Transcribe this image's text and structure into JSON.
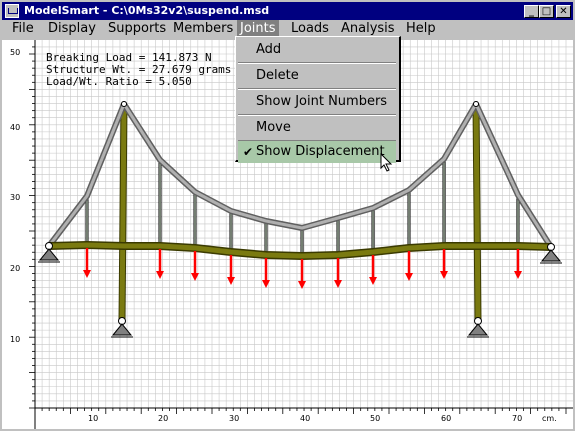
{
  "window": {
    "title": "ModelSmart - C:\\0Ms32v2\\suspend.msd"
  },
  "title_buttons": {
    "minimize": "_",
    "maximize": "□",
    "close": "✕"
  },
  "menu": [
    "File",
    "Display",
    "Supports",
    "Members",
    "Joints",
    "Loads",
    "Analysis",
    "Help"
  ],
  "joints_menu": {
    "items": [
      {
        "label": "Add",
        "checked": false
      },
      {
        "label": "Delete",
        "checked": false
      },
      {
        "label": "Show Joint Numbers",
        "checked": false
      },
      {
        "label": "Move",
        "checked": false
      },
      {
        "label": "Show Displacement",
        "checked": true
      }
    ],
    "checkmark": "✔"
  },
  "info": {
    "breaking_load": "Breaking Load   = 141.873 N",
    "structure_wt": "Structure Wt.   = 27.679 grams",
    "ratio": "Load/Wt. Ratio  = 5.050"
  },
  "axes": {
    "y_labels": [
      "50",
      "40",
      "30",
      "20",
      "10"
    ],
    "x_labels": [
      "10",
      "20",
      "30",
      "40",
      "50",
      "60",
      "70",
      "cm."
    ]
  },
  "colors": {
    "deck": "#7a7a10",
    "cable": "#909090",
    "hanger": "#005020",
    "load_arrow": "#ff0000",
    "grid": "#c8c8c8",
    "menu_highlight": "#a8c8a8",
    "titlebar": "#000080"
  }
}
